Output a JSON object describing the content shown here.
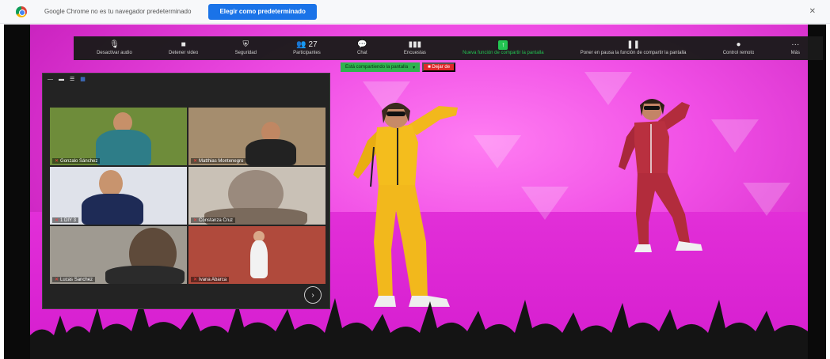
{
  "infobar": {
    "message": "Google Chrome no es tu navegador predeterminado",
    "default_button": "Elegir como predeterminado",
    "close_icon": "close-icon"
  },
  "toolbar": {
    "items": [
      {
        "id": "audio",
        "icon": "🎙",
        "label": "Desactivar audio"
      },
      {
        "id": "video",
        "icon": "■",
        "label": "Detener video"
      },
      {
        "id": "security",
        "icon": "⛨",
        "label": "Seguridad"
      },
      {
        "id": "participants",
        "icon": "👥 27",
        "label": "Participantes"
      },
      {
        "id": "chat",
        "icon": "💬",
        "label": "Chat"
      },
      {
        "id": "polls",
        "icon": "▮▮▮",
        "label": "Encuestas"
      },
      {
        "id": "share",
        "icon": "↑",
        "label": "Nueva función de compartir la pantalla"
      },
      {
        "id": "pause",
        "icon": "❚❚",
        "label": "Poner en pausa la función de compartir la pantalla"
      },
      {
        "id": "remote",
        "icon": "●",
        "label": "Control remoto"
      },
      {
        "id": "more",
        "icon": "···",
        "label": "Más"
      }
    ]
  },
  "share_bar": {
    "status": "Está compartiendo la pantalla",
    "stop_button": "Dejar de"
  },
  "gallery": {
    "tiles": [
      {
        "name": "Gonzalo Sánchez",
        "bg": "#6e8c3a",
        "skin": "#c79069",
        "shirt": "#2e7d88"
      },
      {
        "name": "Matthias Montenegro",
        "bg": "#a58d6e",
        "skin": "#c08763",
        "shirt": "#222222"
      },
      {
        "name": "1 DIY 3",
        "bg": "#dfe2ea",
        "skin": "#c8946e",
        "shirt": "#1e2b56"
      },
      {
        "name": "Constanza Cruz",
        "bg": "#c9c1b6",
        "skin": "#9a8a7d",
        "shirt": "#7a6a5c"
      },
      {
        "name": "Lucas Sanchez",
        "bg": "#9f9a91",
        "skin": "#5e4a3a",
        "shirt": "#2b2b2b"
      },
      {
        "name": "Ivana Abarca",
        "bg": "#b04a3c",
        "skin": "#d9a889",
        "shirt": "#f2f2f2"
      }
    ],
    "next_icon": "chevron-right-icon"
  },
  "colors": {
    "stage": "#e24ae0",
    "share_green": "#23c552",
    "stop_red": "#e02828",
    "chrome_button": "#1a73e8"
  }
}
